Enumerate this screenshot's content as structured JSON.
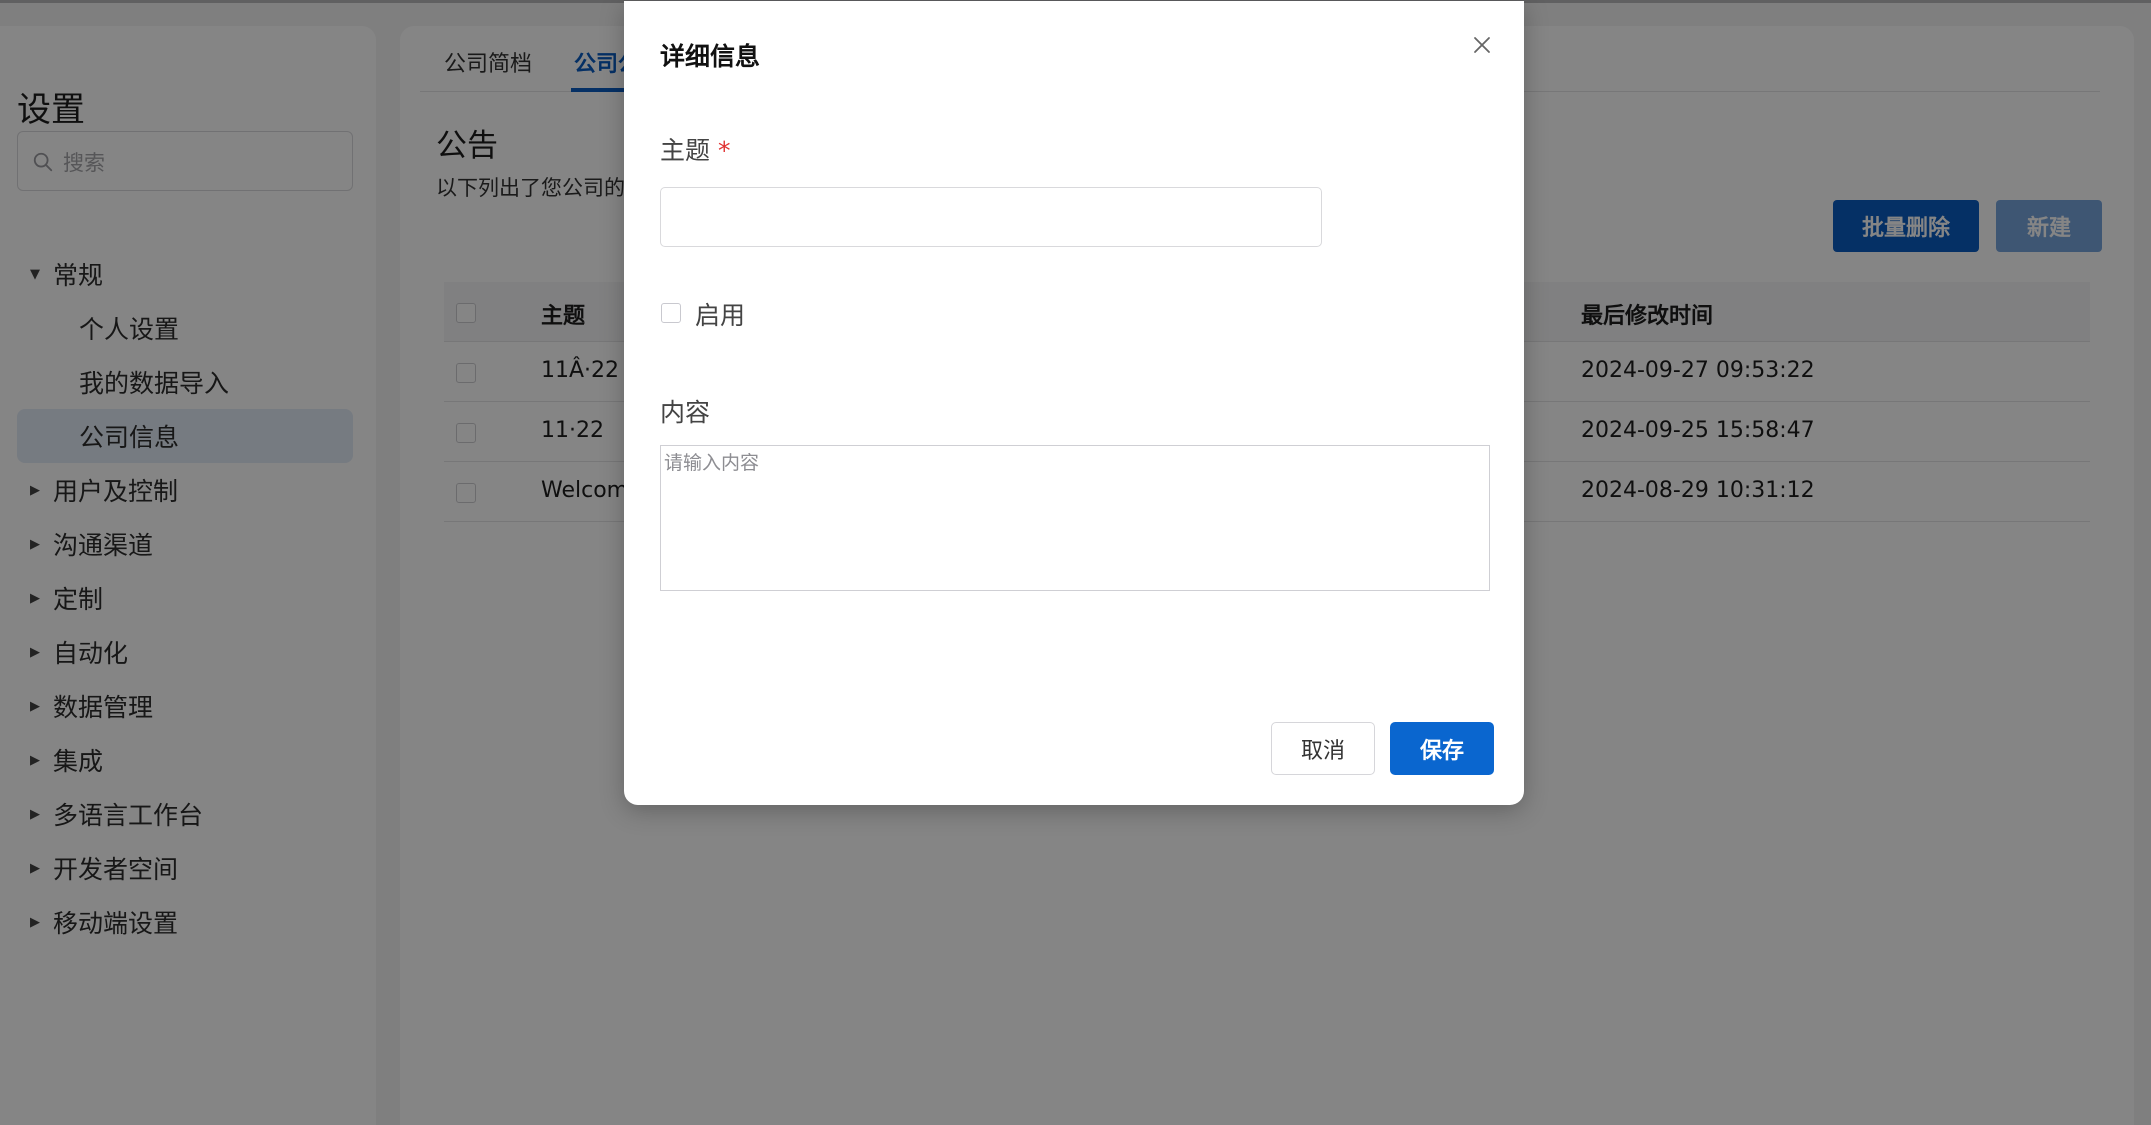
{
  "sidebar": {
    "title": "设置",
    "search_placeholder": "搜索",
    "items": [
      {
        "label": "常规",
        "expanded": true
      },
      {
        "label": "个人设置",
        "sub": true
      },
      {
        "label": "我的数据导入",
        "sub": true
      },
      {
        "label": "公司信息",
        "sub": true,
        "active": true
      },
      {
        "label": "用户及控制"
      },
      {
        "label": "沟通渠道"
      },
      {
        "label": "定制"
      },
      {
        "label": "自动化"
      },
      {
        "label": "数据管理"
      },
      {
        "label": "集成"
      },
      {
        "label": "多语言工作台"
      },
      {
        "label": "开发者空间"
      },
      {
        "label": "移动端设置"
      }
    ]
  },
  "main": {
    "tabs": [
      {
        "label": "公司简档"
      },
      {
        "label": "公司公",
        "active": true
      }
    ],
    "page_title": "公告",
    "page_desc": "以下列出了您公司的",
    "bulk_delete_label": "批量删除",
    "new_label": "新建",
    "table": {
      "headers": {
        "subject": "主题",
        "last_modified": "最后修改时间"
      },
      "rows": [
        {
          "subject": "11Â·22",
          "last_modified": "2024-09-27 09:53:22"
        },
        {
          "subject": "11·22",
          "last_modified": "2024-09-25 15:58:47"
        },
        {
          "subject": "Welcom",
          "last_modified": "2024-08-29 10:31:12"
        }
      ]
    }
  },
  "modal": {
    "title": "详细信息",
    "subject_label": "主题",
    "required_mark": "*",
    "subject_value": "",
    "enable_label": "启用",
    "enabled": false,
    "content_label": "内容",
    "content_placeholder": "请输入内容",
    "content_value": "",
    "cancel_label": "取消",
    "save_label": "保存"
  },
  "colors": {
    "accent": "#0a5cc2",
    "save_button": "#0a66cf",
    "required": "#e03131",
    "overlay": "rgba(0,0,0,0.48)"
  }
}
